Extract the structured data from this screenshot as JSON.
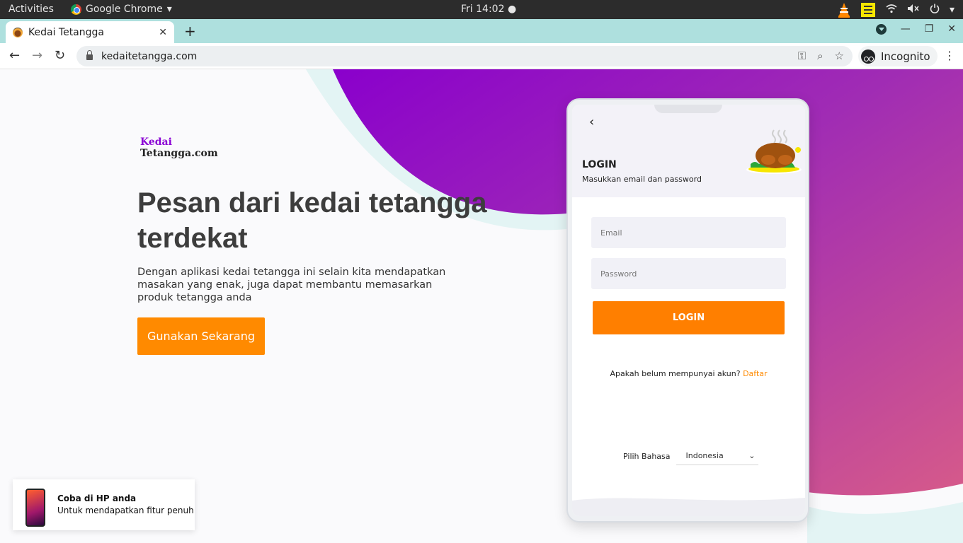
{
  "system_bar": {
    "activities": "Activities",
    "app_name": "Google Chrome",
    "clock": "Fri 14:02"
  },
  "browser": {
    "tab_title": "Kedai Tetangga",
    "url": "kedaitetangga.com",
    "profile_label": "Incognito"
  },
  "landing": {
    "brand_line1": "Kedai",
    "brand_line2": "Tetangga.com",
    "headline": "Pesan dari kedai tetangga terdekat",
    "description": "Dengan aplikasi kedai tetangga ini selain kita mendapatkan masakan yang enak, juga dapat membantu memasarkan produk tetangga anda",
    "cta_label": "Gunakan Sekarang"
  },
  "login": {
    "title": "LOGIN",
    "subtitle": "Masukkan email dan password",
    "email_placeholder": "Email",
    "password_placeholder": "Password",
    "button_label": "LOGIN",
    "signup_prompt": "Apakah belum mempunyai akun?",
    "signup_link": "Daftar",
    "language_label": "Pilih Bahasa",
    "language_value": "Indonesia"
  },
  "promo": {
    "title": "Coba di HP anda",
    "subtitle": "Untuk mendapatkan fitur penuh"
  },
  "colors": {
    "accent_orange": "#ff8a00",
    "brand_purple": "#9400cc",
    "tabstrip": "#aee0de"
  }
}
